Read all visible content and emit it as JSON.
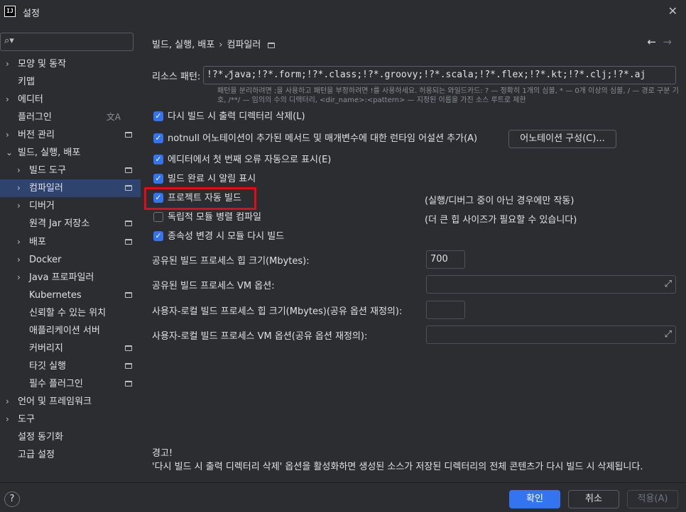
{
  "window": {
    "app_icon": "IJ",
    "title": "설정"
  },
  "sidebar": {
    "search_placeholder": "",
    "items": [
      {
        "label": "모양 및 동작",
        "arrow": "›",
        "mark": false
      },
      {
        "label": "키맵",
        "arrow": "",
        "mark": false
      },
      {
        "label": "에디터",
        "arrow": "›",
        "mark": false
      },
      {
        "label": "플러그인",
        "arrow": "",
        "mark": false
      },
      {
        "label": "버전 관리",
        "arrow": "›",
        "mark": true
      },
      {
        "label": "빌드, 실행, 배포",
        "arrow": "⌄",
        "mark": false
      },
      {
        "label": "빌드 도구",
        "arrow": "›",
        "mark": true
      },
      {
        "label": "컴파일러",
        "arrow": "›",
        "mark": true
      },
      {
        "label": "디버거",
        "arrow": "›",
        "mark": false
      },
      {
        "label": "원격 Jar 저장소",
        "arrow": "",
        "mark": true
      },
      {
        "label": "배포",
        "arrow": "›",
        "mark": true
      },
      {
        "label": "Docker",
        "arrow": "›",
        "mark": false
      },
      {
        "label": "Java 프로파일러",
        "arrow": "›",
        "mark": false
      },
      {
        "label": "Kubernetes",
        "arrow": "",
        "mark": true
      },
      {
        "label": "신뢰할 수 있는 위치",
        "arrow": "",
        "mark": false
      },
      {
        "label": "애플리케이션 서버",
        "arrow": "",
        "mark": false
      },
      {
        "label": "커버리지",
        "arrow": "",
        "mark": true
      },
      {
        "label": "타깃 실행",
        "arrow": "",
        "mark": true
      },
      {
        "label": "필수 플러그인",
        "arrow": "",
        "mark": true
      },
      {
        "label": "언어 및 프레임워크",
        "arrow": "›",
        "mark": false
      },
      {
        "label": "도구",
        "arrow": "›",
        "mark": false
      },
      {
        "label": "설정 동기화",
        "arrow": "",
        "mark": false
      },
      {
        "label": "고급 설정",
        "arrow": "",
        "mark": false
      }
    ],
    "selected_index": 7,
    "plugin_glyph": "文A"
  },
  "breadcrumb": {
    "parent": "빌드, 실행, 배포",
    "separator": "›",
    "current": "컴파일러"
  },
  "nav": {
    "back": "←",
    "forward": "→"
  },
  "resource": {
    "label": "리소스 패턴:",
    "value": "!?*.java;!?*.form;!?*.class;!?*.groovy;!?*.scala;!?*.flex;!?*.kt;!?*.clj;!?*.aj",
    "hint": "패턴을 분리하려면 ;을 사용하고 패턴을 부정하려면 !를 사용하세요. 허용되는 와일드카드: ? — 정확히 1개의 심볼, * — 0개 이상의 심볼, / — 경로 구분 기호, /**/ — 임의의 수의 디렉터리, <dir_name>:<pattern> — 지정된 이름을 가진 소스 루트로 제한"
  },
  "checks": {
    "clear_output": {
      "label": "다시 빌드 시 출력 디렉터리 삭제(L)",
      "checked": true
    },
    "notnull": {
      "label": "notnull 어노테이션이 추가된 메서드 및 매개변수에 대한 런타임 어설션 추가(A)",
      "checked": true
    },
    "configure_annotations": "어노테이션 구성(C)...",
    "show_first_error": {
      "label": "에디터에서 첫 번째 오류 자동으로 표시(E)",
      "checked": true
    },
    "notify_build": {
      "label": "빌드 완료 시 알림 표시",
      "checked": true
    },
    "auto_build": {
      "label": "프로젝트 자동 빌드",
      "checked": true,
      "note": "(실행/디버그 중이 아닌 경우에만 작동)"
    },
    "parallel": {
      "label": "독립적 모듈 병렬 컴파일",
      "checked": false,
      "note": "(더 큰 힙 사이즈가 필요할 수 있습니다)"
    },
    "rebuild_deps": {
      "label": "종속성 변경 시 모듈 다시 빌드",
      "checked": true
    }
  },
  "fields": {
    "shared_heap_label": "공유된 빌드 프로세스 힙 크기(Mbytes):",
    "shared_heap_value": "700",
    "shared_vm_label": "공유된 빌드 프로세스 VM 옵션:",
    "user_heap_label": "사용자-로컬 빌드 프로세스 힙 크기(Mbytes)(공유 옵션 재정의):",
    "user_vm_label": "사용자-로컬 빌드 프로세스 VM 옵션(공유 옵션 재정의):"
  },
  "warning": {
    "title": "경고!",
    "text": "'다시 빌드 시 출력 디렉터리 삭제' 옵션을 활성화하면 생성된 소스가 저장된 디렉터리의 전체 콘텐츠가 다시 빌드 시 삭제됩니다."
  },
  "footer": {
    "help": "?",
    "ok": "확인",
    "cancel": "취소",
    "apply": "적용(A)"
  },
  "colors": {
    "background": "#2b2d30",
    "accent": "#3574f0",
    "selected": "#2e436e",
    "highlight": "#e30b17"
  }
}
